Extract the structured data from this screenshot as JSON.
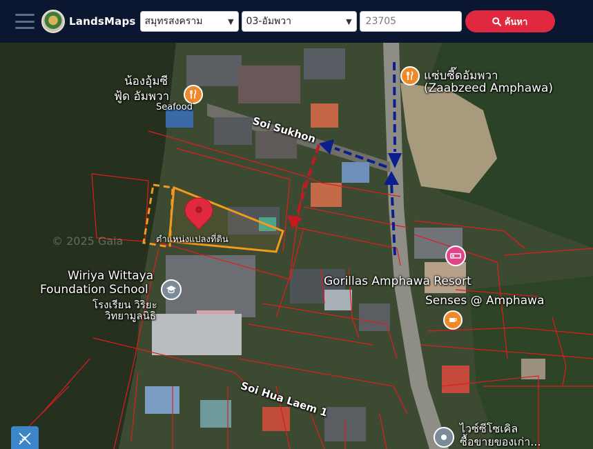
{
  "header": {
    "brand": "LandsMaps",
    "province": "สมุทรสงคราม",
    "district": "03-อัมพวา",
    "parcel_no": "23705",
    "search_label": "ค้นหา"
  },
  "map": {
    "labels": {
      "restaurant_north": "แซ่บซี๊ดอัมพวา",
      "restaurant_north_en": "(Zaabzeed Amphawa)",
      "seafood_th1": "น้องอุ้มซี",
      "seafood_th2": "ฟู้ด อัมพวา",
      "seafood_en": "Seafood",
      "soi_sukhon": "Soi Sukhon",
      "parcel_label": "ตำแหน่งแปลงที่ดิน",
      "watermark": "© 2025 Gaia",
      "school_en1": "Wiriya Wittaya",
      "school_en2": "Foundation School",
      "school_th1": "โรงเรียน วิริยะ",
      "school_th2": "วิทยามูลนิธิ",
      "resort": "Gorillas Amphawa Resort",
      "senses": "Senses @ Amphawa",
      "soi_hua_laem": "Soi Hua Laem 1",
      "shop_th1": "ไวซ์ซีโซเคิล",
      "shop_th2": "ซื้อขายของเก่า..."
    },
    "icons": [
      "menu-icon",
      "landsmaps-logo",
      "search-icon",
      "restaurant-icon",
      "hotel-icon",
      "cafe-icon",
      "school-icon",
      "location-pin-icon",
      "pencil-ruler-icon"
    ],
    "colors": {
      "header_bg": "#0b1730",
      "search_button": "#e0283f",
      "parcel_outline": "#f39a1e",
      "boundary_lines": "#e01c1c",
      "route_arrows_blue": "#0a1f8c",
      "route_arrows_red": "#c8171f",
      "pin": "#e0283f"
    }
  }
}
